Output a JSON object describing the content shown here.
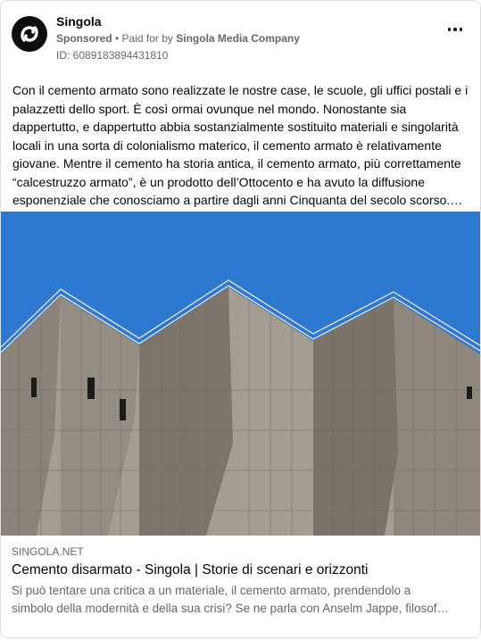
{
  "post": {
    "page_name": "Singola",
    "sponsored_label": "Sponsored",
    "bullet": " • ",
    "paid_prefix": "Paid for by ",
    "company": "Singola Media Company",
    "ad_id": "ID: 6089183894431810",
    "more_icon": "more-horizontal-icon",
    "body": "Con il cemento armato sono realizzate le nostre case, le scuole, gli uffici postali e i\npalazzetti dello sport. È così ormai ovunque nel mondo. Nonostante sia\ndappertutto, e dappertutto abbia sostanzialmente sostituito materiali e singolarità\nlocali in una sorta di colonialismo materico, il cemento armato è relativamente\ngiovane. Mentre il cemento ha storia antica, il cemento armato, più correttamente\n“calcestruzzo armato”, è un prodotto dell’Ottocento e ha avuto la diffusione\nesponenziale che conosciamo a partire dagli anni Cinquanta del secolo scorso.…"
  },
  "link": {
    "domain": "SINGOLA.NET",
    "title": "Cemento disarmato - Singola | Storie di scenari e orizzonti",
    "description": "Si può tentare una critica a un materiale, il cemento armato, prendendolo a\nsimbolo della modernità e della sua crisi? Se ne parla con Anselm Jappe, filosof…"
  },
  "colors": {
    "sky": "#2d79d2",
    "concrete": "#a29b90",
    "muted_text": "#65676b"
  }
}
